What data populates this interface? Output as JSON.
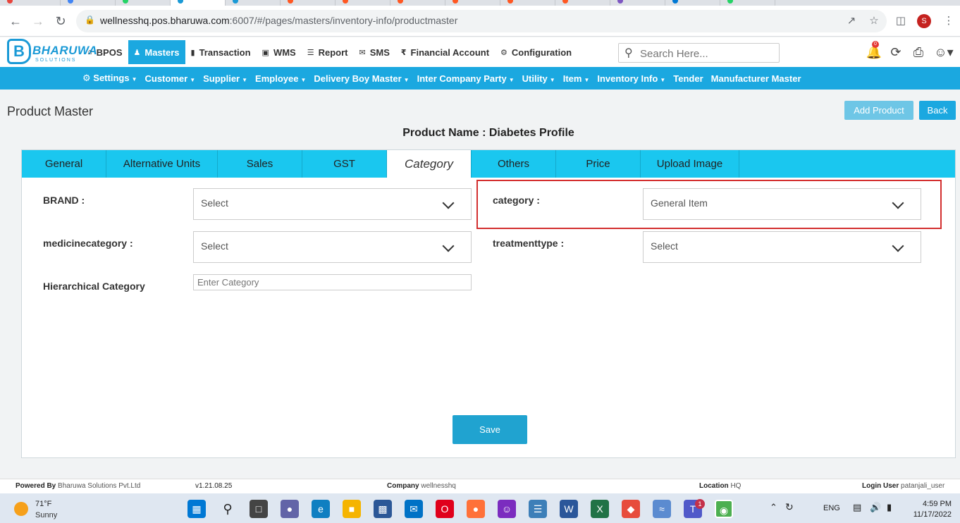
{
  "browser": {
    "url_host": "wellnesshq.pos.bharuwa.com",
    "url_path": ":6007/#/pages/masters/inventory-info/productmaster",
    "profile_initial": "S"
  },
  "brand": {
    "name": "BHARUWA",
    "sub": "SOLUTIONS",
    "letter": "B"
  },
  "topmenu": [
    {
      "label": "BPOS",
      "icon": "home-icon"
    },
    {
      "label": "Masters",
      "icon": "user-icon",
      "active": true
    },
    {
      "label": "Transaction",
      "icon": "bar-chart-icon"
    },
    {
      "label": "WMS",
      "icon": "box-icon"
    },
    {
      "label": "Report",
      "icon": "list-icon"
    },
    {
      "label": "SMS",
      "icon": "chat-icon"
    },
    {
      "label": "Financial Account",
      "icon": "rupee-icon"
    },
    {
      "label": "Configuration",
      "icon": "gear-icon"
    }
  ],
  "search": {
    "placeholder": "Search Here..."
  },
  "notifications": {
    "count": "0"
  },
  "subnav": [
    {
      "label": "Settings",
      "dropdown": true,
      "icon": true
    },
    {
      "label": "Customer",
      "dropdown": true
    },
    {
      "label": "Supplier",
      "dropdown": true
    },
    {
      "label": "Employee",
      "dropdown": true
    },
    {
      "label": "Delivery Boy Master",
      "dropdown": true
    },
    {
      "label": "Inter Company Party",
      "dropdown": true
    },
    {
      "label": "Utility",
      "dropdown": true
    },
    {
      "label": "Item",
      "dropdown": true
    },
    {
      "label": "Inventory Info",
      "dropdown": true
    },
    {
      "label": "Tender",
      "dropdown": false
    },
    {
      "label": "Manufacturer Master",
      "dropdown": false
    }
  ],
  "page": {
    "title": "Product Master",
    "add_product": "Add Product",
    "back": "Back",
    "product_name": "Product Name : Diabetes Profile"
  },
  "tabs": [
    {
      "label": "General"
    },
    {
      "label": "Alternative Units"
    },
    {
      "label": "Sales"
    },
    {
      "label": "GST"
    },
    {
      "label": "Category",
      "active": true
    },
    {
      "label": "Others"
    },
    {
      "label": "Price"
    },
    {
      "label": "Upload Image"
    }
  ],
  "form": {
    "brand_label": "BRAND :",
    "brand_value": "Select",
    "category_label": "category :",
    "category_value": "General Item",
    "medicine_label": "medicinecategory :",
    "medicine_value": "Select",
    "treatment_label": "treatmenttype :",
    "treatment_value": "Select",
    "hier_label": "Hierarchical Category",
    "hier_placeholder": "Enter Category",
    "save": "Save"
  },
  "footer": {
    "powered_label": "Powered By",
    "powered_value": "Bharuwa Solutions Pvt.Ltd",
    "version": "v1.21.08.25",
    "company_label": "Company",
    "company_value": "wellnesshq",
    "location_label": "Location",
    "location_value": "HQ",
    "login_label": "Login User",
    "login_value": "patanjali_user"
  },
  "taskbar": {
    "temp": "71°F",
    "condition": "Sunny",
    "lang": "ENG",
    "time": "4:59 PM",
    "date": "11/17/2022",
    "teams_badge": "1"
  }
}
